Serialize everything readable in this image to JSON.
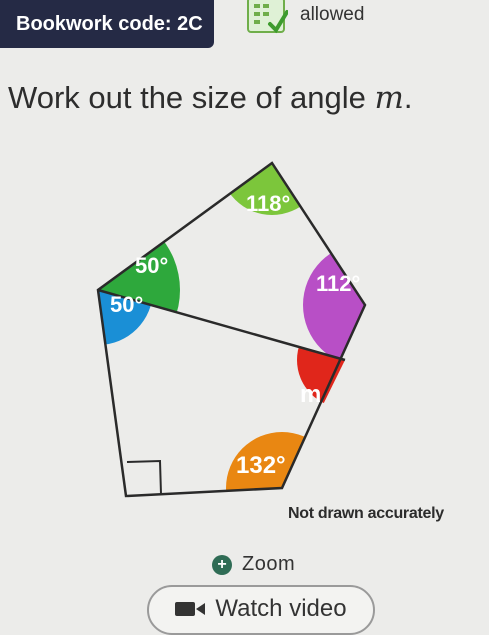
{
  "header": {
    "bookwork_label": "Bookwork code: 2C",
    "calculator_status": "allowed",
    "calculator_icon": "calculator-icon"
  },
  "question": {
    "text_prefix": "Work out the size of angle ",
    "variable": "m",
    "text_suffix": "."
  },
  "diagram": {
    "angles": [
      {
        "label": "118°",
        "color": "#7cc63b"
      },
      {
        "label": "50°",
        "color": "#2ea83c"
      },
      {
        "label": "50°",
        "color": "#1a8fd6"
      },
      {
        "label": "112°",
        "color": "#b84fc6"
      },
      {
        "label": "m",
        "color": "#e0261b"
      },
      {
        "label": "132°",
        "color": "#e98712"
      }
    ],
    "right_angle_marker": true,
    "note": "Not drawn accurately"
  },
  "actions": {
    "zoom_label": "Zoom",
    "zoom_icon": "zoom-in-icon",
    "watch_label": "Watch video",
    "watch_icon": "video-camera-icon"
  }
}
